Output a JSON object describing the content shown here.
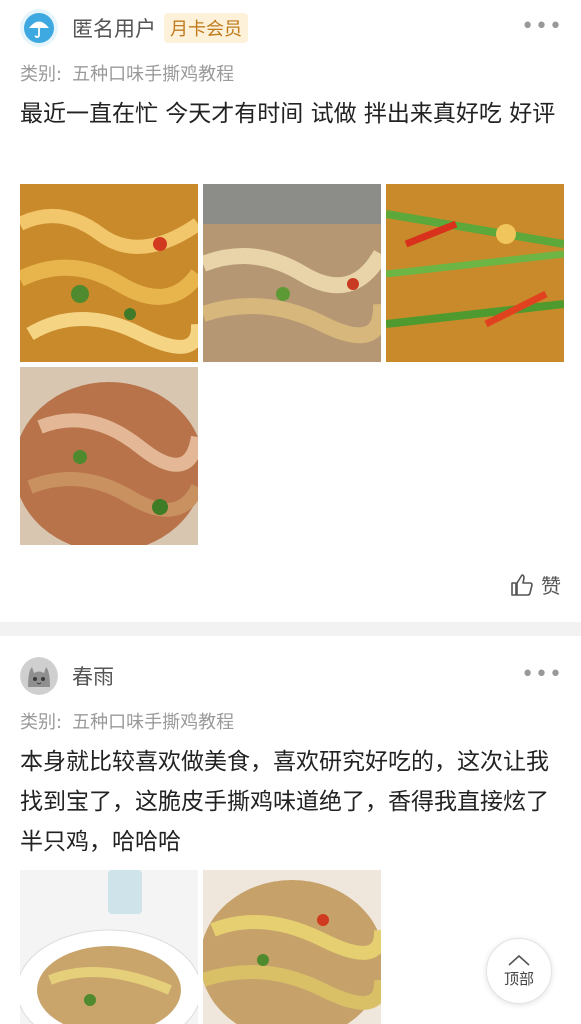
{
  "posts": [
    {
      "username": "匿名用户",
      "badge": "月卡会员",
      "category_label": "类别:",
      "category": "五种口味手撕鸡教程",
      "text": "最近一直在忙 今天才有时间 试做  拌出来真好吃 好评",
      "image_count": 4,
      "like_label": "赞"
    },
    {
      "username": "春雨",
      "category_label": "类别:",
      "category": "五种口味手撕鸡教程",
      "text": "本身就比较喜欢做美食，喜欢研究好吃的，这次让我找到宝了，这脆皮手撕鸡味道绝了，香得我直接炫了半只鸡，哈哈哈",
      "image_count": 2
    }
  ],
  "more_icon": "more-dots-icon",
  "back_to_top_label": "顶部",
  "colors": {
    "badge_bg": "#fdf1d9",
    "badge_text": "#c07a1c",
    "avatar_blue": "#3ea8e0",
    "divider": "#f2f2f2"
  }
}
